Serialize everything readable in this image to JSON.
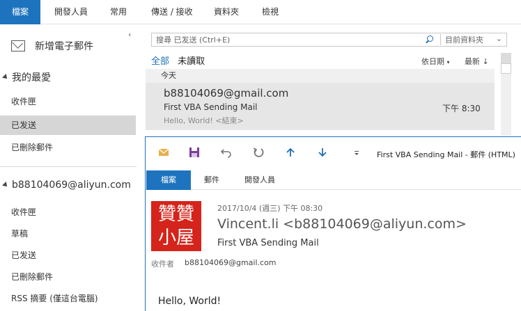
{
  "ribbon": {
    "tabs": [
      {
        "label": "檔案",
        "active": true
      },
      {
        "label": "開發人員"
      },
      {
        "label": "常用"
      },
      {
        "label": "傳送 / 接收"
      },
      {
        "label": "資料夾"
      },
      {
        "label": "檢視"
      }
    ]
  },
  "nav": {
    "new_mail": "新增電子郵件",
    "favorites_header": "我的最愛",
    "favorites": [
      "收件匣",
      "已发送",
      "已刪除郵件"
    ],
    "account_header": "b88104069@aliyun.com",
    "account_folders": [
      "收件匣",
      "草稿",
      "已发送",
      "已刪除郵件",
      "RSS 摘要 (僅這台電腦)"
    ],
    "collapse_glyph": "‹"
  },
  "list": {
    "search_placeholder": "搜尋 已发送 (Ctrl+E)",
    "search_scope": "目前資料夾",
    "filter_all": "全部",
    "filter_unread": "未讀取",
    "sort_by": "依日期",
    "sort_order": "最新 ↓",
    "group_today": "今天",
    "item": {
      "from": "b88104069@gmail.com",
      "subject": "First VBA Sending Mail",
      "time": "下午 8:30",
      "preview": "Hello, World! <結束>"
    }
  },
  "message": {
    "window_title": "First VBA Sending Mail - 郵件 (HTML)",
    "tabs": [
      {
        "label": "檔案",
        "active": true
      },
      {
        "label": "郵件"
      },
      {
        "label": "開發人員"
      }
    ],
    "stamp_text": "贊贊小屋",
    "date": "2017/10/4 (週三) 下午 08:30",
    "sender": "Vincent.li <b88104069@aliyun.com>",
    "subject": "First VBA Sending Mail",
    "to_label": "收件者",
    "to_value": "b88104069@gmail.com",
    "body": "Hello, World!"
  },
  "colors": {
    "accent": "#1e73be",
    "selected_bg": "#d6d6d6",
    "stamp_red": "#d4241b"
  }
}
